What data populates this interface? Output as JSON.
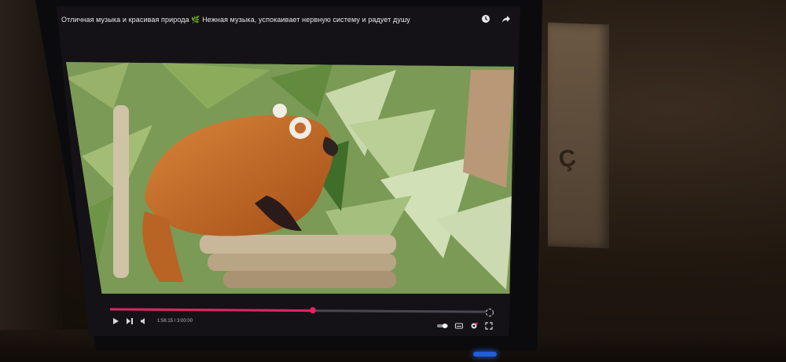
{
  "window": {
    "title": "Отличная музыка и красивая природа 🌿 Нежная музыка, успокаивает нервную систему и радует душу"
  },
  "header": {
    "icons": [
      "clock-icon",
      "share-icon"
    ]
  },
  "player": {
    "progress_fraction": 0.54,
    "progress_color": "#e0245e",
    "time_text": "1:56:15 / 3:00:00",
    "left_controls": [
      "play-icon",
      "next-icon",
      "volume-icon"
    ],
    "right_controls": [
      "autoplay-toggle-icon",
      "subtitles-icon",
      "settings-icon",
      "fullscreen-icon"
    ]
  },
  "video_content": {
    "subject": "red panda among bamboo"
  }
}
